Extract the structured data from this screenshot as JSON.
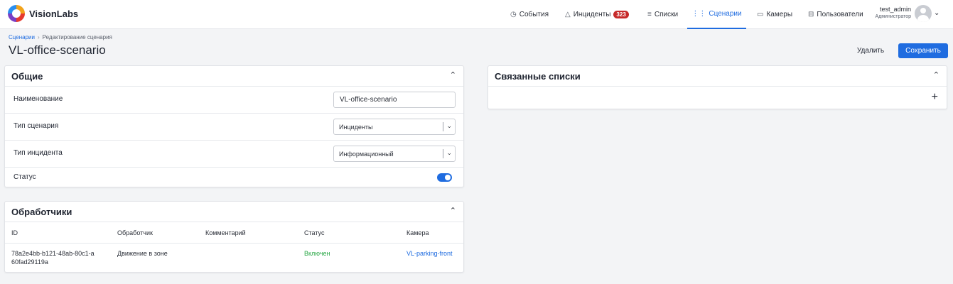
{
  "app": {
    "logo_text": "VisionLabs"
  },
  "nav": [
    {
      "label": "События",
      "icon": "clock-icon"
    },
    {
      "label": "Инциденты",
      "icon": "warning-icon",
      "badge": "323"
    },
    {
      "label": "Списки",
      "icon": "list-icon"
    },
    {
      "label": "Сценарии",
      "icon": "scenario-icon",
      "active": true
    },
    {
      "label": "Камеры",
      "icon": "camera-icon"
    },
    {
      "label": "Пользователи",
      "icon": "users-icon"
    }
  ],
  "user": {
    "name": "test_admin",
    "role": "Администратор"
  },
  "breadcrumb": {
    "parent": "Сценарии",
    "current": "Редактирование сценария"
  },
  "page": {
    "title": "VL-office-scenario",
    "delete_label": "Удалить",
    "save_label": "Сохранить"
  },
  "general": {
    "title": "Общие",
    "name_label": "Наименование",
    "name_value": "VL-office-scenario",
    "type_label": "Тип сценария",
    "type_value": "Инциденты",
    "incident_type_label": "Тип инцидента",
    "incident_type_value": "Информационный",
    "status_label": "Статус",
    "status_enabled": true
  },
  "handlers": {
    "title": "Обработчики",
    "columns": [
      "ID",
      "Обработчик",
      "Комментарий",
      "Статус",
      "Камера"
    ],
    "rows": [
      {
        "id": "78a2e4bb-b121-48ab-80c1-a60fad29119a",
        "handler": "Движение в зоне",
        "comment": "",
        "status": "Включен",
        "camera": "VL-parking-front"
      }
    ]
  },
  "linked_lists": {
    "title": "Связанные списки"
  },
  "colors": {
    "accent": "#1f6ce0",
    "badge": "#c62a2a",
    "status_on": "#28a745"
  }
}
